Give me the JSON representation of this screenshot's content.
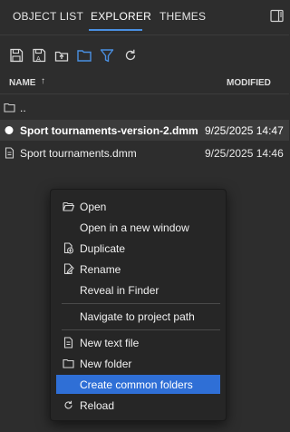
{
  "tabs": [
    {
      "label": "OBJECT LIST"
    },
    {
      "label": "EXPLORER"
    },
    {
      "label": "THEMES"
    }
  ],
  "toolbar": {
    "icons": [
      "save-icon",
      "save-as-icon",
      "upload-icon",
      "folder-icon",
      "filter-icon",
      "reload-icon"
    ],
    "accent": "#4a90e2"
  },
  "columns": {
    "name": "NAME",
    "sort_indicator": "↑",
    "modified": "MODIFIED"
  },
  "rows": [
    {
      "name": "..",
      "modified": "",
      "icon": "folder-icon"
    },
    {
      "name": "Sport tournaments-version-2.dmm",
      "modified": "9/25/2025 14:47",
      "icon": "active-dot-icon",
      "selected": true
    },
    {
      "name": "Sport tournaments.dmm",
      "modified": "9/25/2025 14:46",
      "icon": "file-icon"
    }
  ],
  "context_menu": {
    "items": [
      {
        "label": "Open",
        "icon": "folder-open-icon"
      },
      {
        "label": "Open in a new window",
        "icon": ""
      },
      {
        "label": "Duplicate",
        "icon": "duplicate-icon"
      },
      {
        "label": "Rename",
        "icon": "rename-icon"
      },
      {
        "label": "Reveal in Finder",
        "icon": ""
      },
      {
        "label": "Navigate to project path",
        "icon": ""
      },
      {
        "label": "New text file",
        "icon": "new-file-icon"
      },
      {
        "label": "New folder",
        "icon": "new-folder-icon"
      },
      {
        "label": "Create common folders",
        "icon": "",
        "highlighted": true
      },
      {
        "label": "Reload",
        "icon": "reload-icon"
      }
    ],
    "highlight_color": "#2f6fd6"
  }
}
